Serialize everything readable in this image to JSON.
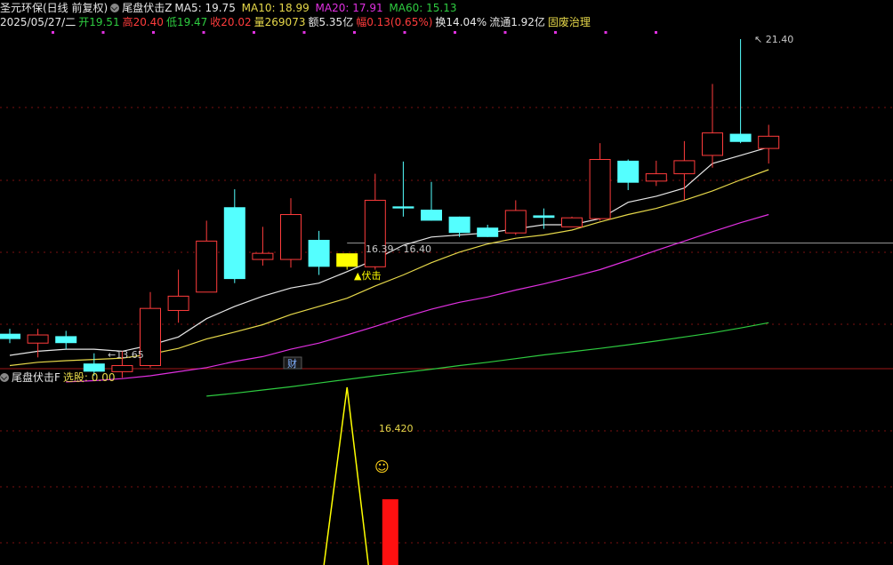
{
  "header": {
    "stock": "圣元环保(日线 前复权)",
    "indicator_main": "尾盘伏击Z",
    "ma5": "MA5: 19.75",
    "ma10": "MA10: 18.99",
    "ma20": "MA20: 17.91",
    "ma60": "MA60: 15.13",
    "date": "2025/05/27/二",
    "open": "开19.51",
    "high": "高20.40",
    "low": "低19.47",
    "close": "收20.02",
    "volume": "量269073",
    "amount": "额5.35亿",
    "amp": "幅0.13(0.65%)",
    "turnover": "换14.04%",
    "float": "流通1.92亿",
    "concept": "固废治理"
  },
  "bottom_panel": {
    "indicator": "尾盘伏击F",
    "select": "选股: 0.00",
    "annotation": "16.420",
    "smiley": "☺"
  },
  "colors": {
    "bull": "#ff3c3c",
    "bear": "#54ffff",
    "ma5": "#e6e6e6",
    "ma10": "#e6d84a",
    "ma20": "#e030e0",
    "ma60": "#2ecc40",
    "signal": "#ffff00",
    "wm": "#ff2a2a"
  },
  "chart_data": [
    {
      "type": "candlestick",
      "title": "圣元环保(日线 前复权)",
      "ylim": [
        12.5,
        22.0
      ],
      "candles": [
        {
          "o": 14.18,
          "h": 14.3,
          "l": 13.95,
          "c": 14.05
        },
        {
          "o": 13.95,
          "h": 14.3,
          "l": 13.6,
          "c": 14.15
        },
        {
          "o": 14.12,
          "h": 14.25,
          "l": 13.8,
          "c": 13.95
        },
        {
          "o": 13.45,
          "h": 13.7,
          "l": 13.15,
          "c": 13.25
        },
        {
          "o": 13.25,
          "h": 13.75,
          "l": 13.1,
          "c": 13.4
        },
        {
          "o": 13.4,
          "h": 15.2,
          "l": 13.35,
          "c": 14.8
        },
        {
          "o": 14.75,
          "h": 15.75,
          "l": 14.45,
          "c": 15.1
        },
        {
          "o": 15.2,
          "h": 16.95,
          "l": 15.2,
          "c": 16.45
        },
        {
          "o": 17.28,
          "h": 17.72,
          "l": 15.42,
          "c": 15.52
        },
        {
          "o": 16.0,
          "h": 16.8,
          "l": 15.85,
          "c": 16.15
        },
        {
          "o": 16.0,
          "h": 17.5,
          "l": 15.8,
          "c": 17.1
        },
        {
          "o": 16.48,
          "h": 16.7,
          "l": 15.62,
          "c": 15.82
        },
        {
          "o": 16.15,
          "h": 16.15,
          "l": 15.75,
          "c": 15.82
        },
        {
          "o": 15.82,
          "h": 18.1,
          "l": 15.75,
          "c": 17.45
        },
        {
          "o": 17.3,
          "h": 18.4,
          "l": 17.05,
          "c": 17.25
        },
        {
          "o": 17.22,
          "h": 17.9,
          "l": 16.95,
          "c": 16.95
        },
        {
          "o": 17.05,
          "h": 17.05,
          "l": 16.55,
          "c": 16.65
        },
        {
          "o": 16.78,
          "h": 16.85,
          "l": 16.55,
          "c": 16.55
        },
        {
          "o": 16.65,
          "h": 17.45,
          "l": 16.6,
          "c": 17.2
        },
        {
          "o": 17.08,
          "h": 17.25,
          "l": 16.75,
          "c": 17.02
        },
        {
          "o": 16.8,
          "h": 17.05,
          "l": 16.8,
          "c": 17.02
        },
        {
          "o": 17.0,
          "h": 18.85,
          "l": 16.95,
          "c": 18.45
        },
        {
          "o": 18.42,
          "h": 18.45,
          "l": 17.7,
          "c": 17.88
        },
        {
          "o": 17.92,
          "h": 18.42,
          "l": 17.8,
          "c": 18.1
        },
        {
          "o": 18.1,
          "h": 18.9,
          "l": 17.45,
          "c": 18.42
        },
        {
          "o": 18.55,
          "h": 20.3,
          "l": 18.25,
          "c": 19.1
        },
        {
          "o": 19.08,
          "h": 21.4,
          "l": 18.85,
          "c": 18.88
        },
        {
          "o": 18.72,
          "h": 19.3,
          "l": 18.35,
          "c": 19.02
        }
      ],
      "ma5": [
        13.65,
        13.75,
        13.8,
        13.8,
        13.75,
        13.9,
        14.1,
        14.55,
        14.85,
        15.1,
        15.3,
        15.42,
        15.7,
        16.0,
        16.35,
        16.55,
        16.6,
        16.65,
        16.75,
        16.85,
        16.85,
        17.0,
        17.4,
        17.55,
        17.75,
        18.35,
        18.55,
        18.75
      ],
      "ma10": [
        13.4,
        13.48,
        13.52,
        13.55,
        13.58,
        13.68,
        13.82,
        14.05,
        14.22,
        14.4,
        14.65,
        14.85,
        15.05,
        15.35,
        15.62,
        15.92,
        16.18,
        16.38,
        16.52,
        16.6,
        16.72,
        16.92,
        17.1,
        17.25,
        17.45,
        17.68,
        17.95,
        18.2
      ],
      "ma20": [
        null,
        null,
        13.0,
        13.03,
        13.08,
        13.15,
        13.25,
        13.35,
        13.5,
        13.62,
        13.8,
        13.95,
        14.15,
        14.36,
        14.58,
        14.78,
        14.95,
        15.08,
        15.25,
        15.4,
        15.57,
        15.75,
        15.98,
        16.22,
        16.45,
        16.68,
        16.9,
        17.1
      ],
      "ma60": [
        null,
        null,
        null,
        null,
        null,
        null,
        null,
        12.65,
        12.72,
        12.8,
        12.88,
        12.97,
        13.06,
        13.15,
        13.23,
        13.31,
        13.4,
        13.48,
        13.57,
        13.66,
        13.74,
        13.82,
        13.91,
        14.0,
        14.1,
        14.2,
        14.32,
        14.45
      ],
      "labels": {
        "low": "13.65",
        "high": "21.40",
        "range": "16.39 - 16.40",
        "signal": "▲伏击",
        "cai": "财"
      },
      "level": 16.4
    },
    {
      "type": "line",
      "title": "尾盘伏击F",
      "signal_index": 12,
      "bar_index": 13
    }
  ]
}
